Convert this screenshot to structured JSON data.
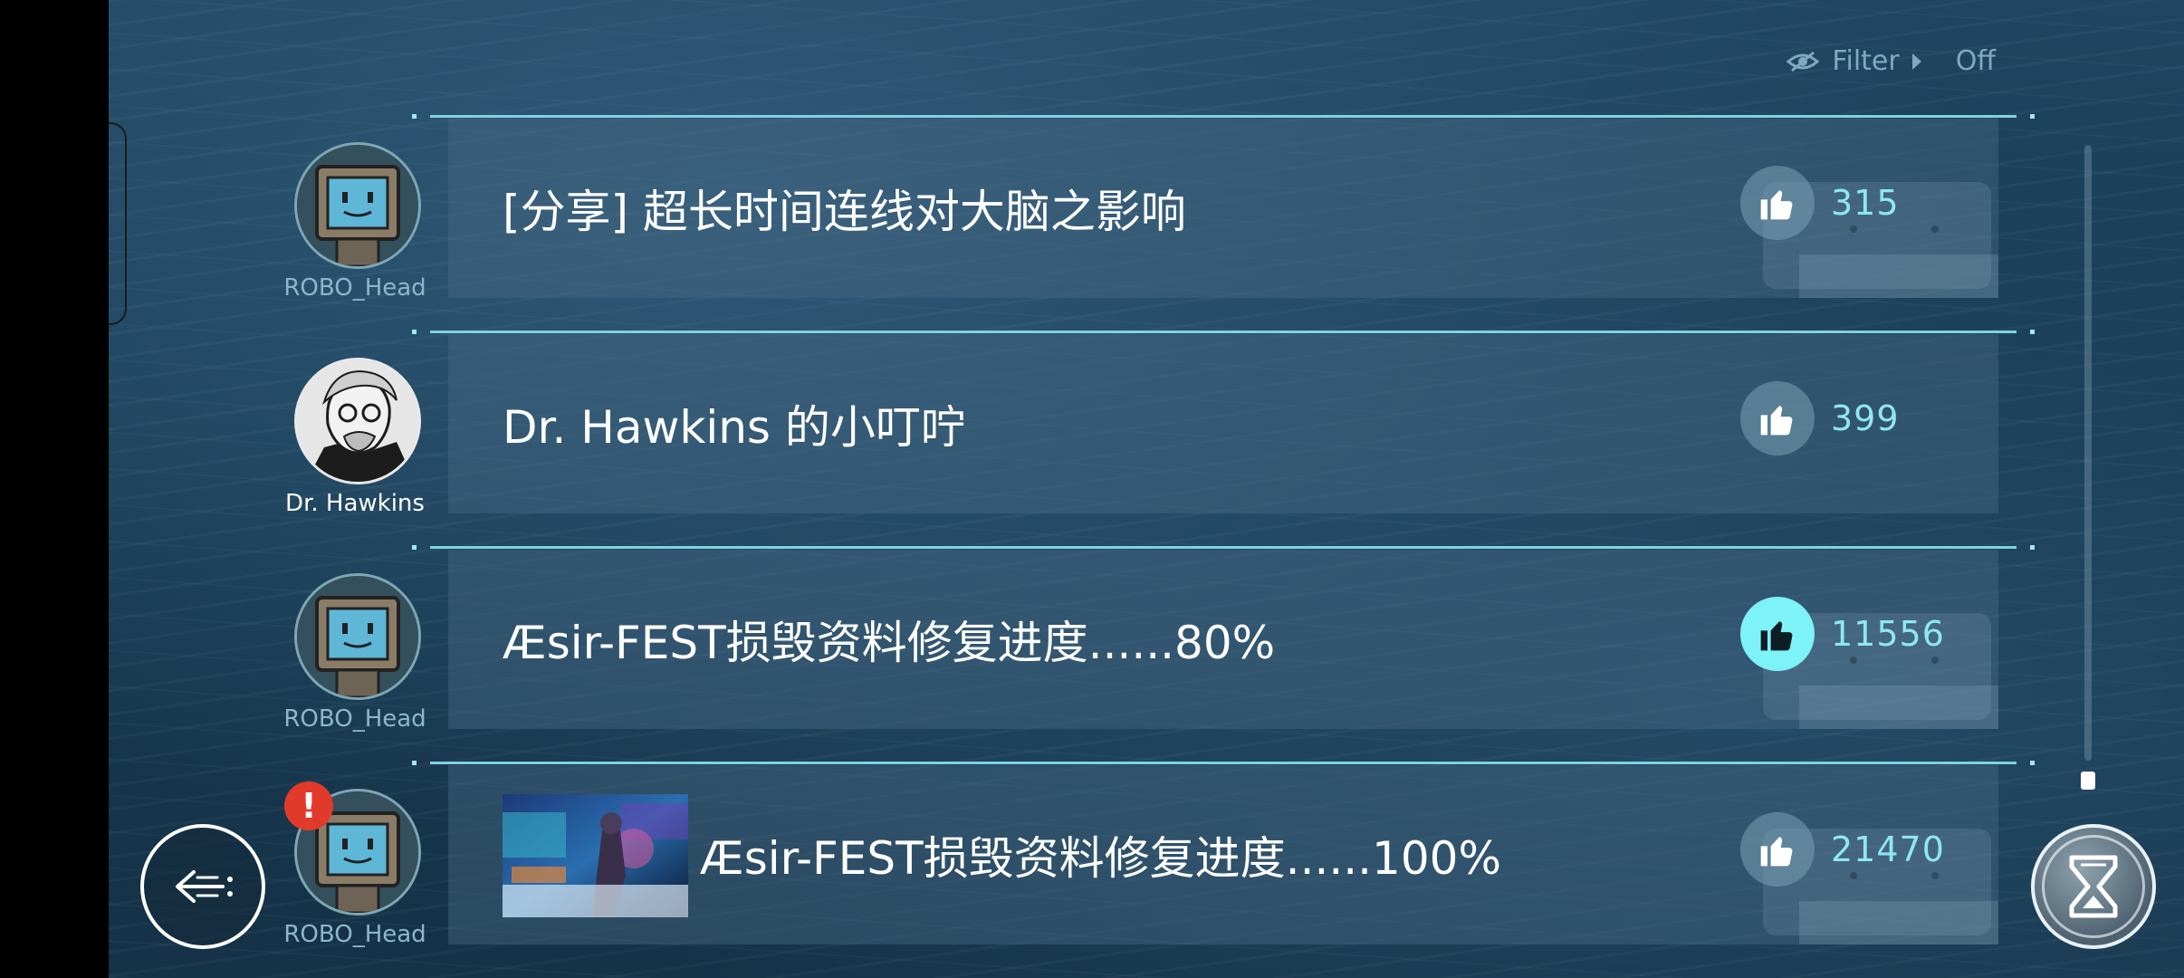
{
  "filter": {
    "label": "Filter",
    "value": "Off",
    "icon": "eye-slash-icon"
  },
  "posts": [
    {
      "title": "[分享] 超长时间连线对大脑之影响",
      "likes": "315",
      "liked": false,
      "author": "ROBO_Head",
      "avatar": "robo-head",
      "alert": false,
      "has_thumbnail": false
    },
    {
      "title": "Dr. Hawkins 的小叮咛",
      "likes": "399",
      "liked": false,
      "author": "Dr. Hawkins",
      "avatar": "dr-hawkins",
      "alert": false,
      "has_thumbnail": false
    },
    {
      "title": "Æsir-FEST损毁资料修复进度......80%",
      "likes": "11556",
      "liked": true,
      "author": "ROBO_Head",
      "avatar": "robo-head",
      "alert": false,
      "has_thumbnail": false
    },
    {
      "title": "Æsir-FEST损毁资料修复进度......100%",
      "likes": "21470",
      "liked": false,
      "author": "ROBO_Head",
      "avatar": "robo-head",
      "alert": true,
      "alert_text": "!",
      "has_thumbnail": true
    }
  ],
  "colors": {
    "accent": "#7df2f7",
    "line": "#7fd3e0",
    "alert": "#e23a2a"
  },
  "buttons": {
    "back_icon": "back-arrow-icon",
    "menu_icon": "hourglass-icon"
  }
}
